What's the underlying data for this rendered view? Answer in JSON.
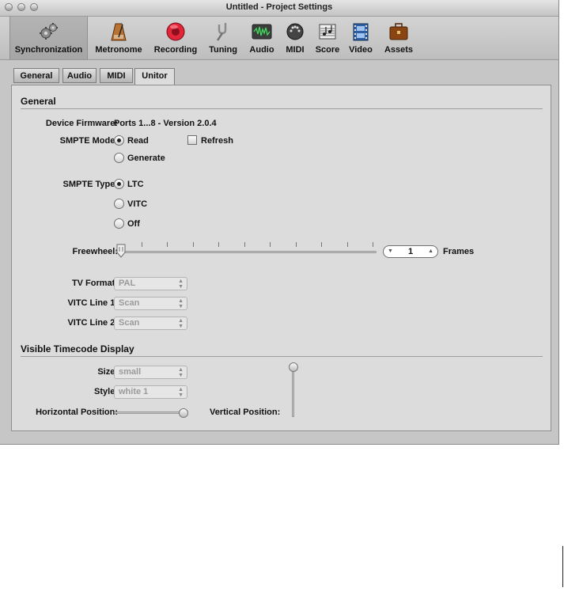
{
  "window": {
    "title": "Untitled - Project Settings"
  },
  "toolbar": {
    "items": [
      {
        "label": "Synchronization",
        "icon": "gears-icon",
        "selected": true
      },
      {
        "label": "Metronome",
        "icon": "metronome-icon"
      },
      {
        "label": "Recording",
        "icon": "record-icon"
      },
      {
        "label": "Tuning",
        "icon": "tuning-fork-icon"
      },
      {
        "label": "Audio",
        "icon": "audio-waveform-icon"
      },
      {
        "label": "MIDI",
        "icon": "midi-connector-icon"
      },
      {
        "label": "Score",
        "icon": "score-icon"
      },
      {
        "label": "Video",
        "icon": "film-icon"
      },
      {
        "label": "Assets",
        "icon": "briefcase-icon"
      }
    ]
  },
  "tabs": [
    {
      "label": "General"
    },
    {
      "label": "Audio"
    },
    {
      "label": "MIDI"
    },
    {
      "label": "Unitor",
      "active": true
    }
  ],
  "general": {
    "heading": "General",
    "firmware_label": "Device Firmware:",
    "firmware_value": "Ports 1...8 - Version 2.0.4",
    "smpte_mode_label": "SMPTE Mode:",
    "smpte_mode_options": [
      "Read",
      "Generate"
    ],
    "smpte_mode_selected": "Read",
    "refresh_label": "Refresh",
    "refresh_checked": false,
    "smpte_type_label": "SMPTE Type:",
    "smpte_type_options": [
      "LTC",
      "VITC",
      "Off"
    ],
    "smpte_type_selected": "LTC",
    "freewheel_label": "Freewheel:",
    "freewheel_value": "1",
    "frames_label": "Frames",
    "tv_format_label": "TV Format:",
    "tv_format_value": "PAL",
    "vitc1_label": "VITC Line 1:",
    "vitc1_value": "Scan",
    "vitc2_label": "VITC Line 2:",
    "vitc2_value": "Scan"
  },
  "timecode": {
    "heading": "Visible Timecode Display",
    "size_label": "Size:",
    "size_value": "small",
    "style_label": "Style:",
    "style_value": "white 1",
    "hpos_label": "Horizontal Position:",
    "vpos_label": "Vertical Position:"
  }
}
